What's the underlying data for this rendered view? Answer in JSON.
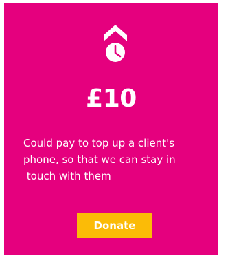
{
  "colors": {
    "card_background": "#e5007e",
    "button_background": "#fbbb07",
    "text": "#ffffff"
  },
  "card": {
    "icon": "arrow-up-clock-icon",
    "amount": "£10",
    "description_lines": [
      "Could pay to top up a client's",
      "phone, so that we can stay in",
      " touch with them"
    ],
    "donate_label": "Donate"
  }
}
